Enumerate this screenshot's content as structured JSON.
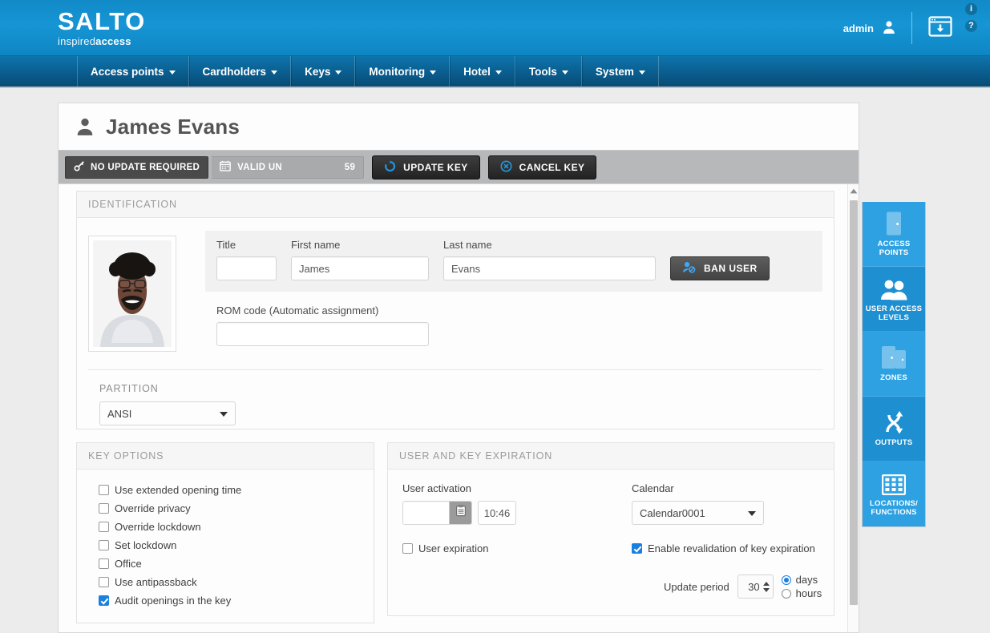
{
  "header": {
    "logo_main": "SALTO",
    "logo_sub_light": "inspired",
    "logo_sub_bold": "access",
    "admin_label": "admin",
    "user_icon": "user-icon",
    "download_icon": "download-window-icon",
    "info_icon": "info-icon",
    "help_icon": "help-icon",
    "info_glyph": "i",
    "help_glyph": "?"
  },
  "nav": {
    "items": [
      {
        "label": "Access points"
      },
      {
        "label": "Cardholders"
      },
      {
        "label": "Keys"
      },
      {
        "label": "Monitoring"
      },
      {
        "label": "Hotel"
      },
      {
        "label": "Tools"
      },
      {
        "label": "System"
      }
    ]
  },
  "page": {
    "title": "James Evans",
    "title_icon": "person-icon"
  },
  "toolbar": {
    "status_label": "NO UPDATE REQUIRED",
    "status_icon": "key-icon",
    "valid_label": "VALID UN",
    "valid_icon": "calendar-icon",
    "valid_value": "59",
    "update_key_label": "UPDATE KEY",
    "update_key_icon": "refresh-icon",
    "cancel_key_label": "CANCEL KEY",
    "cancel_key_icon": "cancel-circle-icon"
  },
  "identification": {
    "panel_title": "IDENTIFICATION",
    "photo_alt": "cardholder-photo",
    "title_label": "Title",
    "title_value": "",
    "title_placeholder": "",
    "first_name_label": "First name",
    "first_name_value": "James",
    "last_name_label": "Last name",
    "last_name_value": "Evans",
    "ban_user_label": "BAN USER",
    "ban_user_icon": "ban-user-icon",
    "rom_code_label": "ROM code (Automatic assignment)",
    "rom_code_value": "",
    "partition_label": "PARTITION",
    "partition_value": "ANSI",
    "partition_options": [
      "ANSI"
    ]
  },
  "key_options": {
    "panel_title": "KEY OPTIONS",
    "items": [
      {
        "label": "Use extended opening time",
        "checked": false
      },
      {
        "label": "Override privacy",
        "checked": false
      },
      {
        "label": "Override lockdown",
        "checked": false
      },
      {
        "label": "Set lockdown",
        "checked": false
      },
      {
        "label": "Office",
        "checked": false
      },
      {
        "label": "Use antipassback",
        "checked": false
      },
      {
        "label": "Audit openings in the key",
        "checked": true
      }
    ]
  },
  "expiration": {
    "panel_title": "USER AND KEY EXPIRATION",
    "user_activation_label": "User activation",
    "activation_date_value": "",
    "activation_date_placeholder": "",
    "activation_calendar_icon": "calendar-picker-icon",
    "activation_time_value": "10:46",
    "user_expiration_label": "User expiration",
    "user_expiration_checked": false,
    "calendar_label": "Calendar",
    "calendar_value": "Calendar0001",
    "calendar_options": [
      "Calendar0001"
    ],
    "revalidation_label": "Enable revalidation of key expiration",
    "revalidation_checked": true,
    "update_period_label": "Update period",
    "update_period_value": "30",
    "unit_days_label": "days",
    "unit_hours_label": "hours",
    "unit_selected": "days"
  },
  "sidebar": {
    "items": [
      {
        "label": "ACCESS POINTS",
        "icon": "door-icon",
        "alt": false
      },
      {
        "label": "USER ACCESS LEVELS",
        "icon": "users-icon",
        "alt": true
      },
      {
        "label": "ZONES",
        "icon": "doors-icon",
        "alt": false
      },
      {
        "label": "OUTPUTS",
        "icon": "outputs-arrows-icon",
        "alt": true
      },
      {
        "label": "LOCATIONS/ FUNCTIONS",
        "icon": "grid-icon",
        "alt": false
      }
    ]
  },
  "scrollbar": {
    "up_arrow_icon": "scroll-up-icon"
  },
  "colors": {
    "header_blue": "#1695d4",
    "nav_blue": "#0a5f91",
    "sidebar_blue": "#2da1e2",
    "sidebar_blue_alt": "#1e8fd1",
    "accent_checkbox": "#1b7fe0",
    "toolbar_gray": "#b7b8ba",
    "dark_button": "#232323"
  }
}
